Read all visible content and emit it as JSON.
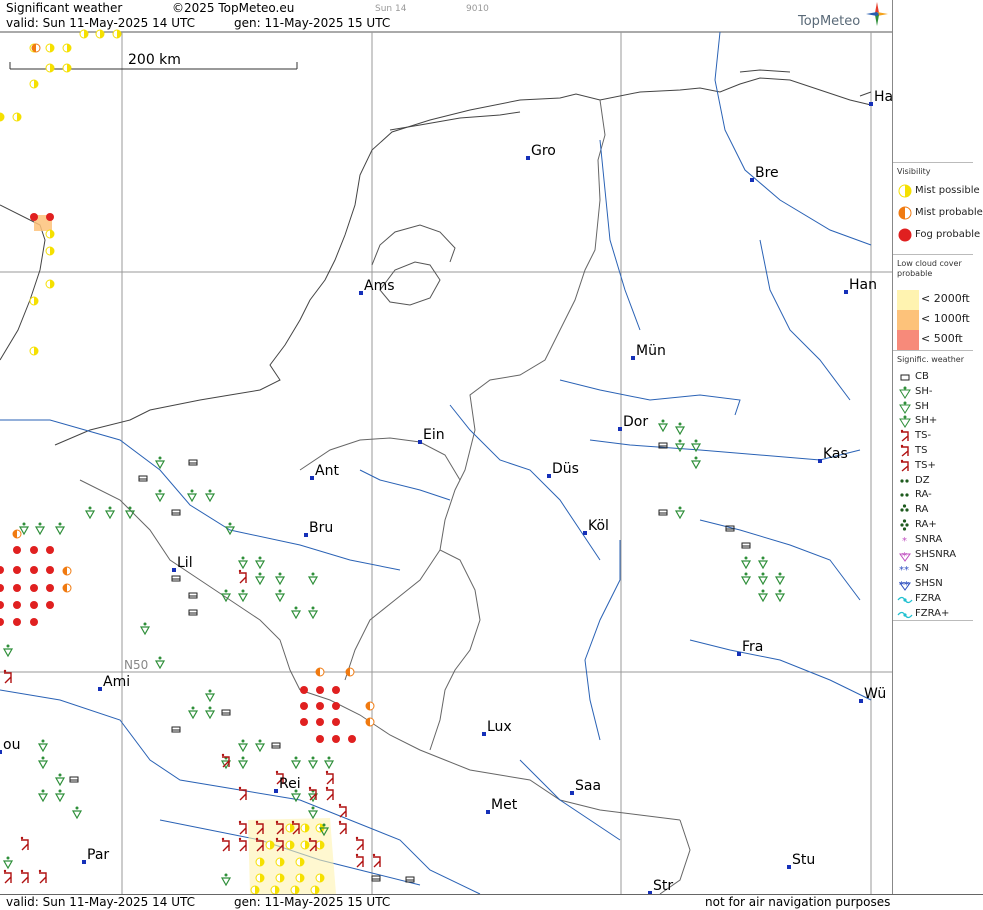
{
  "header": {
    "title": "Significant weather",
    "copyright": "©2025 TopMeteo.eu",
    "day": "Sun 14",
    "code": "9010",
    "valid": "valid:  Sun  11-May-2025  14 UTC",
    "generated": "gen: 11-May-2025 15 UTC",
    "logo": "TopMeteo"
  },
  "map": {
    "scale_label": "200 km",
    "grid_label": "N50",
    "cities": [
      {
        "name": "Ha"
      },
      {
        "name": "Gro"
      },
      {
        "name": "Bre"
      },
      {
        "name": "Ams"
      },
      {
        "name": "Han"
      },
      {
        "name": "Mün"
      },
      {
        "name": "Dor"
      },
      {
        "name": "Ein"
      },
      {
        "name": "Kas"
      },
      {
        "name": "Düs"
      },
      {
        "name": "Ant"
      },
      {
        "name": "Bru"
      },
      {
        "name": "Köl"
      },
      {
        "name": "Lil"
      },
      {
        "name": "Fra"
      },
      {
        "name": "Ami"
      },
      {
        "name": "Wü"
      },
      {
        "name": "Lux"
      },
      {
        "name": "Saa"
      },
      {
        "name": "Rei"
      },
      {
        "name": "Met"
      },
      {
        "name": "ou"
      },
      {
        "name": "Par"
      },
      {
        "name": "Stu"
      },
      {
        "name": "Str"
      }
    ]
  },
  "legend": {
    "visibility_title": "Visibility",
    "visibility": [
      {
        "label": "Mist possible",
        "color": "#f5e000"
      },
      {
        "label": "Mist probable",
        "color": "#f07a10"
      },
      {
        "label": "Fog probable",
        "color": "#e02020"
      }
    ],
    "cloud_title": "Low cloud cover probable",
    "cloud": [
      {
        "label": "< 2000ft",
        "color": "#fff3b0"
      },
      {
        "label": "< 1000ft",
        "color": "#fdc27a"
      },
      {
        "label": "<   500ft",
        "color": "#f78a7a"
      }
    ],
    "sigwx_title": "Signific. weather",
    "sigwx": [
      {
        "label": "CB",
        "icon": "cb-icon"
      },
      {
        "label": "SH-",
        "icon": "shower-light-icon"
      },
      {
        "label": "SH",
        "icon": "shower-icon"
      },
      {
        "label": "SH+",
        "icon": "shower-heavy-icon"
      },
      {
        "label": "TS-",
        "icon": "thunder-light-icon"
      },
      {
        "label": "TS",
        "icon": "thunder-icon"
      },
      {
        "label": "TS+",
        "icon": "thunder-heavy-icon"
      },
      {
        "label": "DZ",
        "icon": "drizzle-icon"
      },
      {
        "label": "RA-",
        "icon": "rain-light-icon"
      },
      {
        "label": "RA",
        "icon": "rain-icon"
      },
      {
        "label": "RA+",
        "icon": "rain-heavy-icon"
      },
      {
        "label": "SNRA",
        "icon": "sleet-icon"
      },
      {
        "label": "SHSNRA",
        "icon": "sleet-shower-icon"
      },
      {
        "label": "SN",
        "icon": "snow-icon"
      },
      {
        "label": "SHSN",
        "icon": "snow-shower-icon"
      },
      {
        "label": "FZRA",
        "icon": "freezing-rain-icon"
      },
      {
        "label": "FZRA+",
        "icon": "freezing-rain-heavy-icon"
      }
    ]
  },
  "footer": {
    "valid": "valid:  Sun  11-May-2025  14 UTC",
    "generated": "gen: 11-May-2025 15 UTC",
    "disclaimer": "not for air navigation purposes"
  }
}
